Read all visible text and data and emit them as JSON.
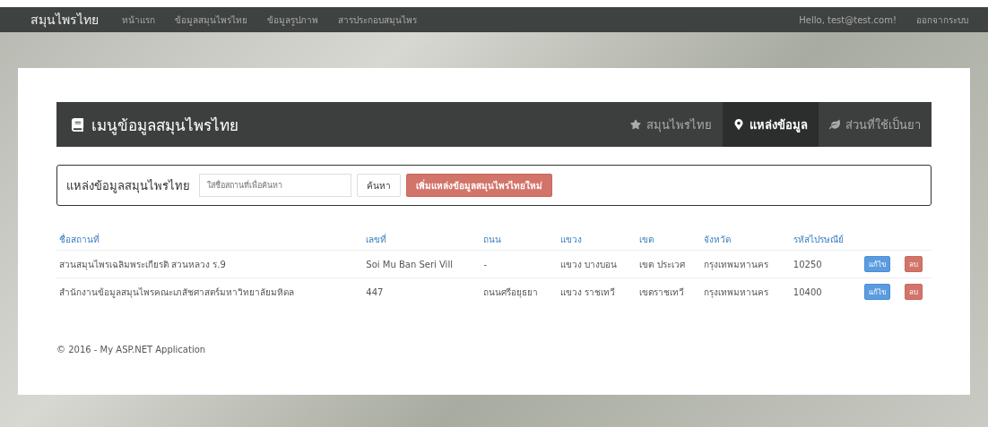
{
  "navbar": {
    "brand": "สมุนไพรไทย",
    "links": [
      "หน้าแรก",
      "ข้อมูลสมุนไพรไทย",
      "ข้อมูลรูปภาพ",
      "สารประกอบสมุนไพร"
    ],
    "greeting": "Hello, test@test.com!",
    "logout": "ออกจากระบบ"
  },
  "panel": {
    "title": "เมนูข้อมูลสมุนไพรไทย",
    "tabs": [
      {
        "label": "สมุนไพรไทย",
        "selected": false
      },
      {
        "label": "แหล่งข้อมูล",
        "selected": true
      },
      {
        "label": "ส่วนที่ใช้เป็นยา",
        "selected": false
      }
    ]
  },
  "search": {
    "label": "แหล่งข้อมูลสมุนไพรไทย",
    "placeholder": "ใส่ชื่อสถานที่เพื่อค้นหา",
    "button": "ค้นหา",
    "add_button": "เพิ่มแหล่งข้อมูลสมุนไพรไทยใหม่"
  },
  "table": {
    "columns": [
      "ชื่อสถานที่",
      "เลขที่",
      "ถนน",
      "แขวง",
      "เขต",
      "จังหวัด",
      "รหัสไปรษณีย์"
    ],
    "rows": [
      {
        "cells": [
          "สวนสมุนไพรเฉลิมพระเกียรติ สวนหลวง ร.9",
          "Soi Mu Ban Seri Vill",
          "-",
          "แขวง บางบอน",
          "เขต ประเวศ",
          "กรุงเทพมหานคร",
          "10250"
        ],
        "edit": "แก้ไข",
        "delete": "ลบ"
      },
      {
        "cells": [
          "สำนักงานข้อมูลสมุนไพรคณะเภสัชศาสตร์มหาวิทยาลัยมหิดล",
          "447",
          "ถนนศรีอยุธยา",
          "แขวง ราชเทวี",
          "เขตราชเทวี",
          "กรุงเทพมหานคร",
          "10400"
        ],
        "edit": "แก้ไข",
        "delete": "ลบ"
      }
    ]
  },
  "footer": "© 2016 - My ASP.NET Application"
}
